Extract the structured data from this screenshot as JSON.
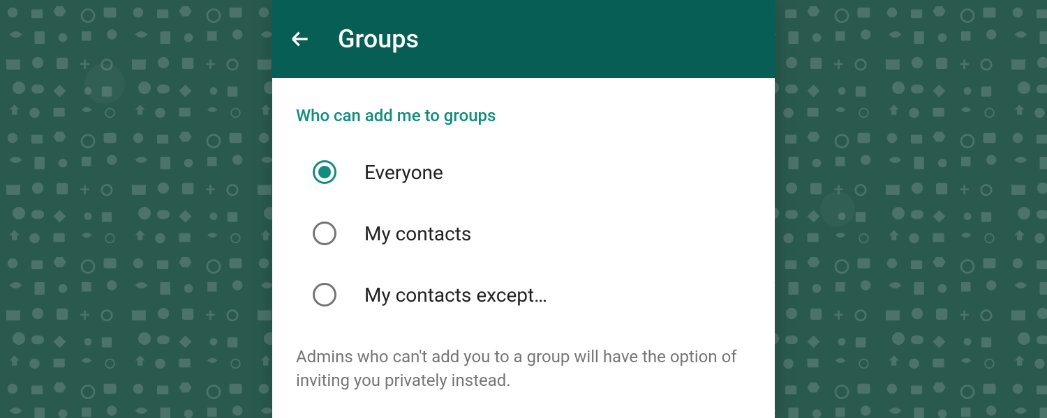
{
  "header": {
    "title": "Groups"
  },
  "section": {
    "title": "Who can add me to groups"
  },
  "options": [
    {
      "label": "Everyone",
      "selected": true
    },
    {
      "label": "My contacts",
      "selected": false
    },
    {
      "label": "My contacts except…",
      "selected": false
    }
  ],
  "help_text": "Admins who can't add you to a group will have the option of inviting you privately instead.",
  "colors": {
    "header_bg": "#075e54",
    "accent": "#128c7e",
    "text_primary": "#212121",
    "text_secondary": "#757575"
  }
}
